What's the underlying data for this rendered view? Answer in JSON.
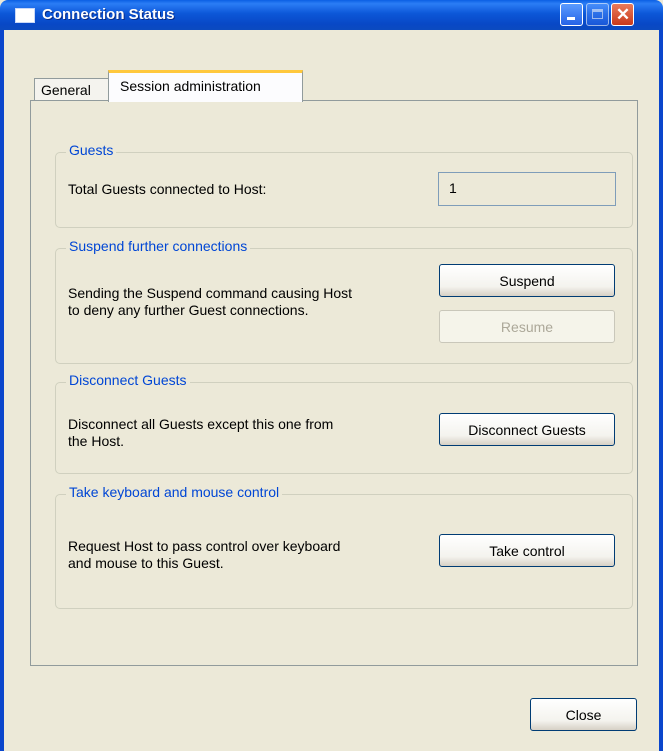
{
  "window": {
    "title": "Connection Status"
  },
  "tabs": {
    "general": "General",
    "session": "Session administration"
  },
  "guests": {
    "legend": "Guests",
    "label": "Total Guests connected to Host:",
    "value": "1"
  },
  "suspend": {
    "legend": "Suspend further connections",
    "line1": "Sending the Suspend command causing Host",
    "line2": "to deny any further Guest connections.",
    "suspend_label": "Suspend",
    "resume_label": "Resume"
  },
  "disconnect": {
    "legend": "Disconnect Guests",
    "line1": "Disconnect all Guests except this one from",
    "line2": "the Host.",
    "button_label": "Disconnect Guests"
  },
  "control": {
    "legend": "Take keyboard and mouse control",
    "line1": "Request Host to pass control over keyboard",
    "line2": "and mouse to this Guest.",
    "button_label": "Take control"
  },
  "footer": {
    "close_label": "Close"
  }
}
